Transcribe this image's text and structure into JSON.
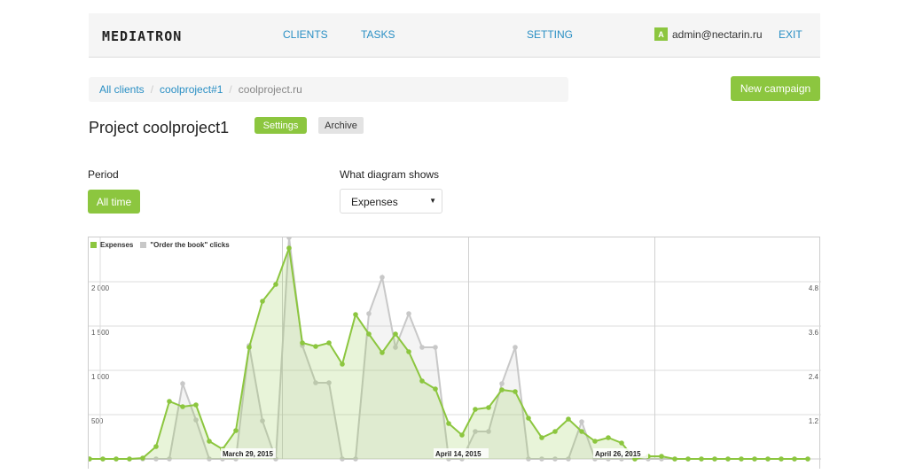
{
  "header": {
    "logo": "MEDIATRON",
    "nav": [
      {
        "label": "CLIENTS"
      },
      {
        "label": "TASKS"
      },
      {
        "label": "SETTING"
      }
    ],
    "user": {
      "avatar_letter": "A",
      "email": "admin@nectarin.ru"
    },
    "exit_label": "EXIT"
  },
  "breadcrumb": {
    "items": [
      "All clients",
      "coolproject#1"
    ],
    "current": "coolproject.ru",
    "separator": "/"
  },
  "new_campaign_label": "New campaign",
  "project": {
    "title": "Project coolproject1",
    "settings_label": "Settings",
    "archive_label": "Archive"
  },
  "filters": {
    "period_label": "Period",
    "period_value": "All time",
    "diagram_label": "What diagram shows",
    "diagram_value": "Expenses",
    "dropdown_arrow": "▼"
  },
  "colors": {
    "accent": "#8cc63f",
    "link": "#2a8fc4",
    "clicks": "#c8c8c8"
  },
  "chart_data": {
    "type": "area",
    "legend": [
      "Expenses",
      "\"Order the book\" clicks"
    ],
    "legend_position": "top-left",
    "y_left": {
      "ticks": [
        "500",
        "1 000",
        "1 500",
        "2 000"
      ],
      "tick_values": [
        500,
        1000,
        1500,
        2000
      ],
      "range": [
        0,
        2500
      ]
    },
    "y_right": {
      "ticks": [
        "1.2",
        "2.4",
        "3.6",
        "4.8"
      ],
      "tick_values": [
        1.2,
        2.4,
        3.6,
        4.8
      ],
      "range": [
        0,
        6
      ]
    },
    "x_labels": [
      {
        "label": "March 29, 2015",
        "index": 10
      },
      {
        "label": "April 14, 2015",
        "index": 26
      },
      {
        "label": "April 26, 2015",
        "index": 38
      }
    ],
    "vlines_at_index": [
      14.5,
      28.5,
      42.5
    ],
    "series": [
      {
        "name": "Expenses",
        "axis": "left",
        "values": [
          0,
          0,
          0,
          0,
          10,
          140,
          650,
          590,
          610,
          200,
          110,
          320,
          1260,
          1780,
          1970,
          2380,
          1310,
          1270,
          1310,
          1070,
          1630,
          1410,
          1200,
          1410,
          1210,
          880,
          790,
          400,
          270,
          560,
          580,
          780,
          760,
          460,
          240,
          310,
          450,
          310,
          200,
          240,
          180,
          0,
          30,
          30,
          0,
          0,
          0,
          0,
          0,
          0,
          0,
          0,
          0,
          0,
          0
        ]
      },
      {
        "name": "\"Order the book\" clicks",
        "axis": "left",
        "values": [
          0,
          0,
          0,
          0,
          0,
          0,
          0,
          850,
          440,
          0,
          0,
          0,
          1280,
          430,
          0,
          2500,
          1280,
          860,
          860,
          0,
          0,
          1640,
          2050,
          1260,
          1640,
          1260,
          1260,
          0,
          0,
          310,
          310,
          850,
          1260,
          0,
          0,
          0,
          0,
          420,
          0,
          0,
          0,
          0,
          0,
          0,
          0,
          0,
          0,
          0,
          0,
          0,
          0,
          0,
          0,
          0,
          0
        ]
      }
    ]
  }
}
